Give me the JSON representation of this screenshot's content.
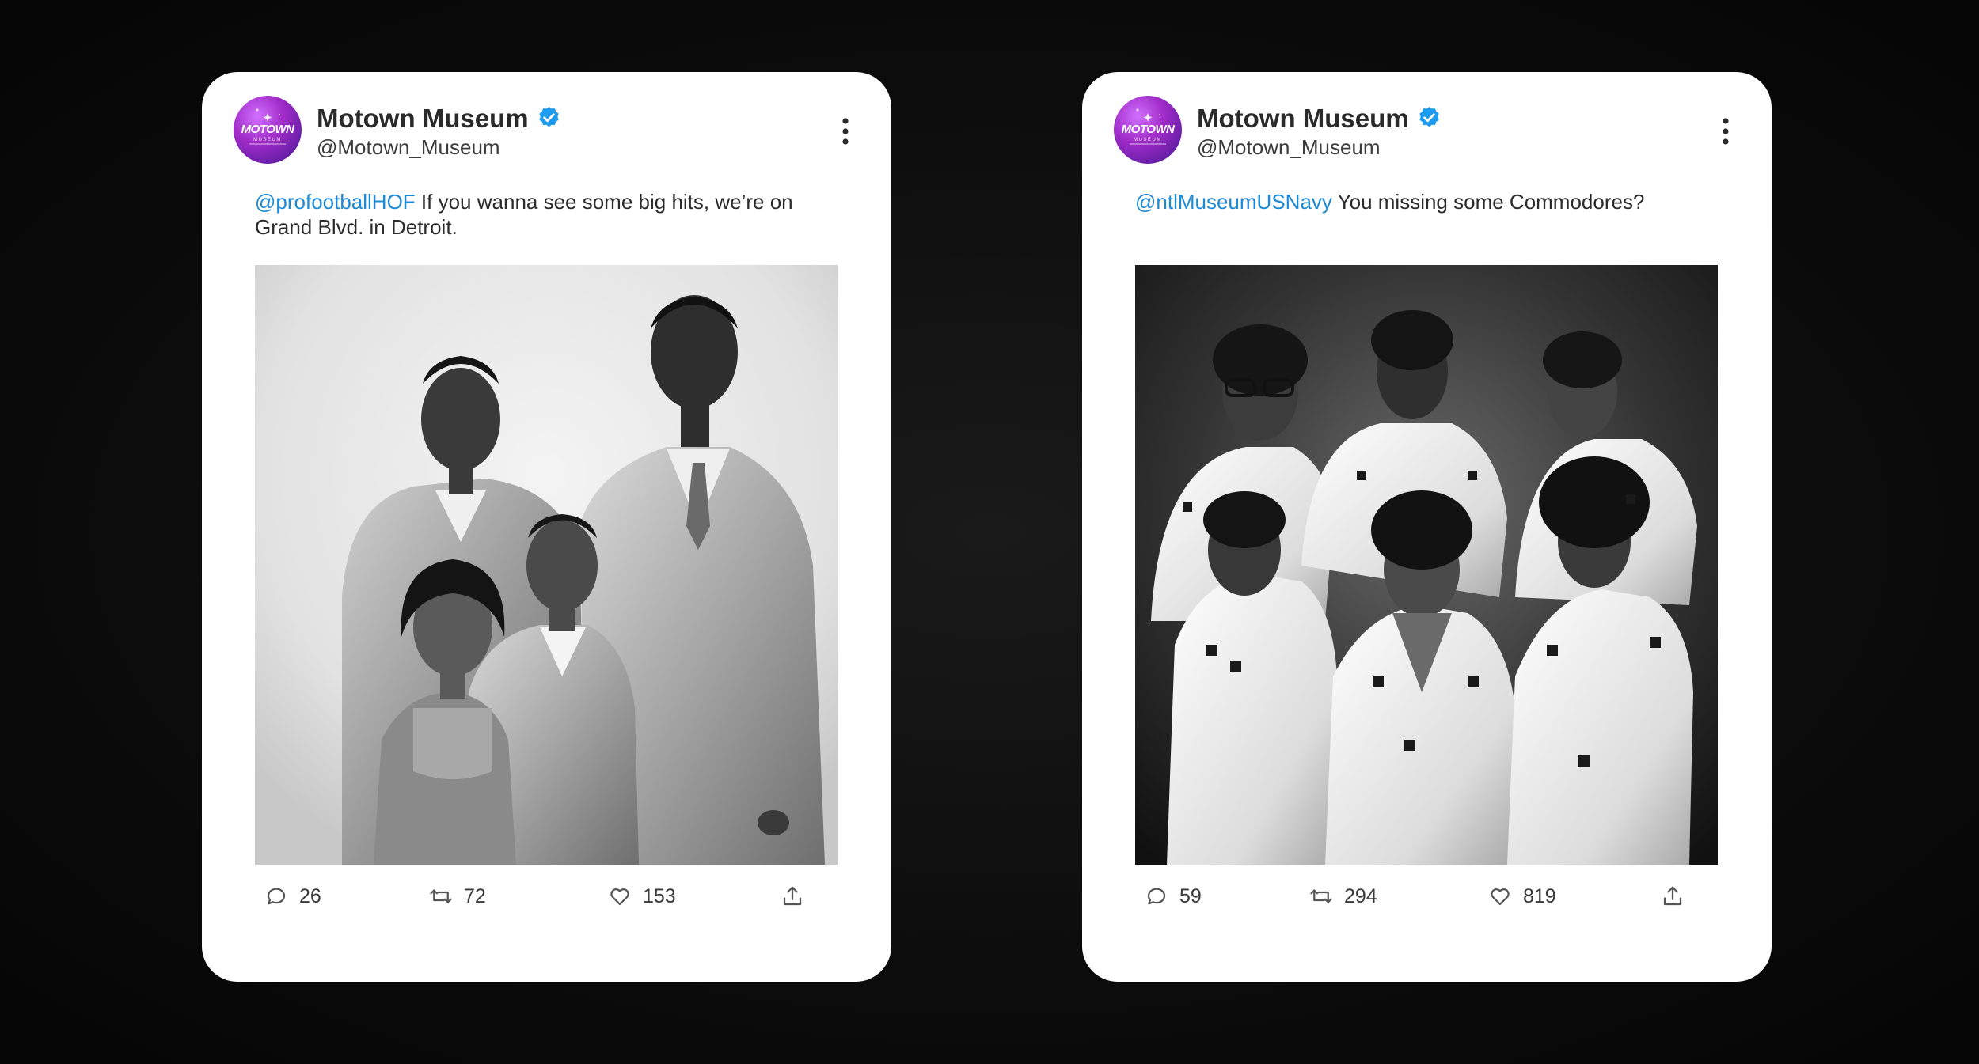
{
  "colors": {
    "background": "#0d0d0d",
    "card": "#ffffff",
    "mention": "#1d8ad6",
    "verified": "#1d9bf0",
    "avatar": "#a22cc9"
  },
  "cards": [
    {
      "avatar": {
        "brand": "MOTOWN",
        "sub": "MUSEUM"
      },
      "display_name": "Motown Museum",
      "handle": "@Motown_Museum",
      "mention": "@profootballHOF",
      "text": " If you wanna see some big hits, we’re on Grand Blvd. in Detroit.",
      "photo_icon": "black-and-white-group-portrait",
      "stats": {
        "replies": "26",
        "retweets": "72",
        "likes": "153"
      }
    },
    {
      "avatar": {
        "brand": "MOTOWN",
        "sub": "MUSEUM"
      },
      "display_name": "Motown Museum",
      "handle": "@Motown_Museum",
      "mention": "@ntlMuseumUSNavy",
      "text": " You missing some Commodores?",
      "photo_icon": "black-and-white-band-portrait",
      "stats": {
        "replies": "59",
        "retweets": "294",
        "likes": "819"
      }
    }
  ]
}
